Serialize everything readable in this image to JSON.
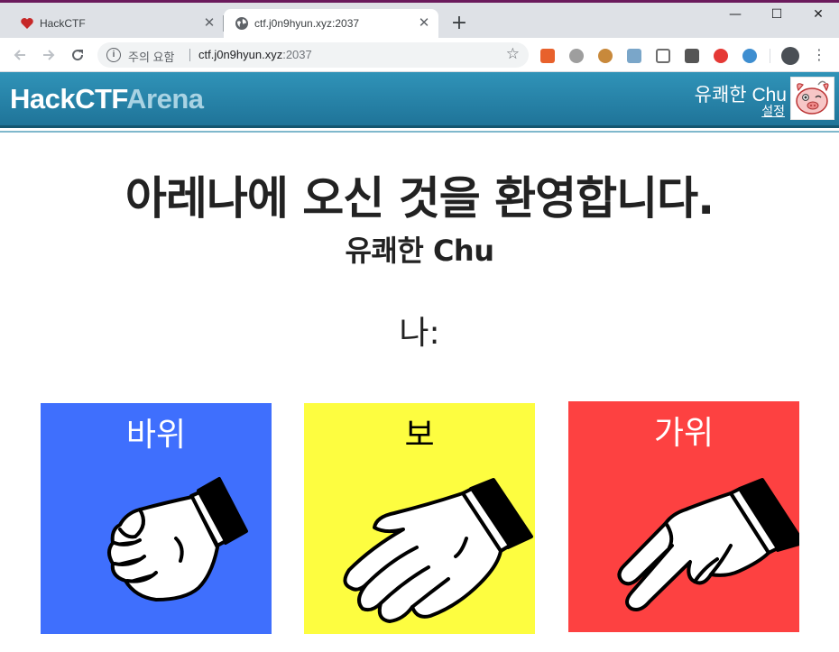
{
  "browser": {
    "tabs": [
      {
        "title": "HackCTF",
        "active": false,
        "favicon": "heart-icon"
      },
      {
        "title": "ctf.j0n9hyun.xyz:2037",
        "active": true,
        "favicon": "globe-icon"
      }
    ],
    "new_tab_label": "+",
    "window_controls": {
      "minimize": "—",
      "maximize": "☐",
      "close": "✕"
    },
    "address": {
      "security_warning": "주의 요함",
      "host": "ctf.j0n9hyun.xyz",
      "port": ":2037"
    }
  },
  "header": {
    "brand_primary": "HackCTF",
    "brand_secondary": "Arena",
    "user_name": "유쾌한 Chu",
    "settings_label": "설정",
    "colors": {
      "bar": "#2a88ad",
      "brand_secondary": "#a9d3e3"
    }
  },
  "main": {
    "title": "아레나에 오신 것을 환영합니다.",
    "subtitle": "유쾌한 Chu",
    "me_label": "나:",
    "choices": [
      {
        "key": "rock",
        "label": "바위",
        "color": "#3f6ffd",
        "label_color": "#ffffff",
        "icon": "fist-hand-icon"
      },
      {
        "key": "paper",
        "label": "보",
        "color": "#fdfd40",
        "label_color": "#000000",
        "icon": "open-hand-icon"
      },
      {
        "key": "scissors",
        "label": "가위",
        "color": "#fd4141",
        "label_color": "#ffffff",
        "icon": "victory-hand-icon"
      }
    ]
  }
}
